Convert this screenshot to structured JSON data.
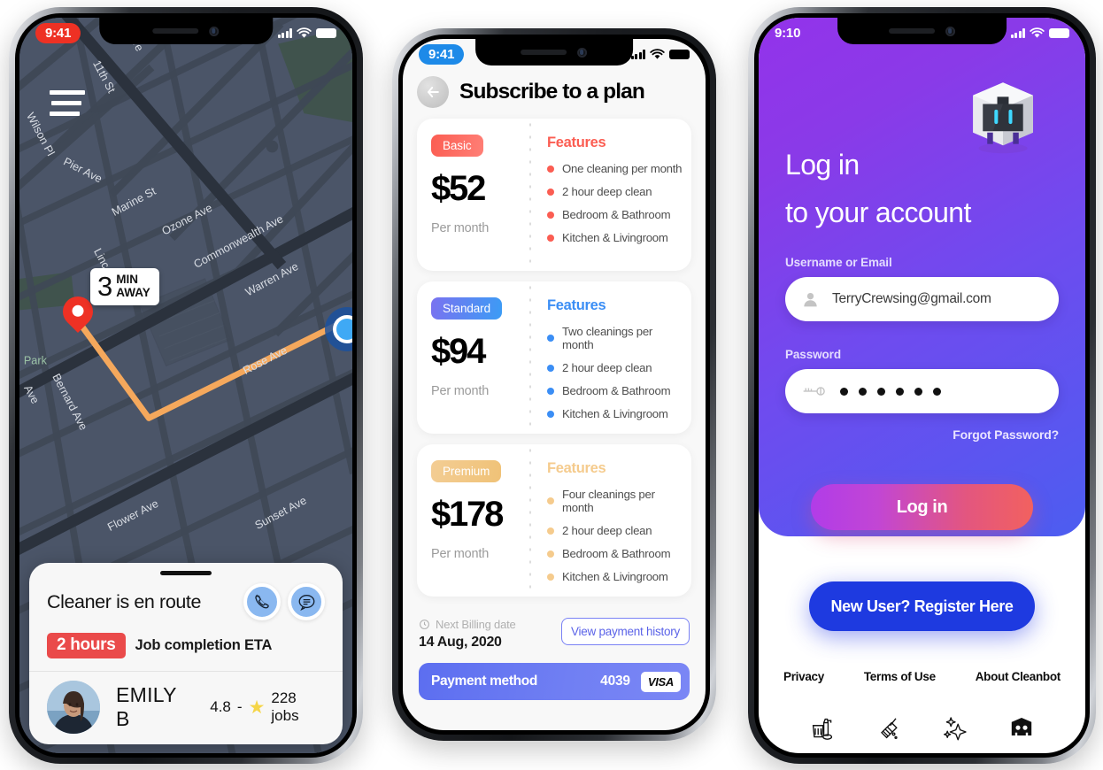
{
  "phone1": {
    "name": "cleaner-tracking-map",
    "status": {
      "time": "9:41",
      "time_bg": "#ee3124",
      "time_color": "#ffffff",
      "signal": "signal-bars-icon",
      "wifi": "wifi-icon",
      "battery": "battery-icon"
    },
    "menu_icon": "hamburger-menu-icon",
    "map": {
      "bg_color": "#4b5568",
      "road_color": "#3b4351",
      "park_color": "#3c5148",
      "route_color": "#f5a85c",
      "street_labels": [
        "11th St",
        "Wilson Pl",
        "Pier Ave",
        "Marine St",
        "Ozone Ave",
        "Commonwealth Ave",
        "Warren Ave",
        "Lincoln Blvd",
        "Rose Ave",
        "Bernard Ave",
        "Flower Ave",
        "Sunset Ave",
        "Park"
      ]
    },
    "eta_badge": {
      "number": "3",
      "line1": "MIN",
      "line2": "AWAY"
    },
    "card": {
      "title": "Cleaner is en route",
      "call_icon": "phone-call-icon",
      "chat_icon": "chat-bubble-icon",
      "eta_value": "2 hours",
      "eta_label": "Job completion ETA",
      "cleaner_name": "EMILY B",
      "rating": "4.8",
      "rating_sep": "-",
      "star_icon": "star-icon",
      "jobs": "228 jobs"
    }
  },
  "phone2": {
    "name": "subscribe-to-a-plan",
    "status": {
      "time": "9:41",
      "time_bg": "#1d8ae8",
      "time_color": "#ffffff",
      "signal": "signal-bars-icon",
      "wifi": "wifi-icon",
      "battery": "battery-icon"
    },
    "back_icon": "back-arrow-icon",
    "title": "Subscribe to a plan",
    "features_heading": "Features",
    "per_month": "Per month",
    "plans": [
      {
        "tag": "Basic",
        "tag_color": "#fb5d52",
        "accent": "#fb5d52",
        "price": "$52",
        "features": [
          "One cleaning per month",
          "2 hour deep clean",
          "Bedroom & Bathroom",
          "Kitchen & Livingroom"
        ]
      },
      {
        "tag": "Standard",
        "tag_color": "#4b8ef4",
        "accent": "#3b8ef5",
        "price": "$94",
        "features": [
          "Two cleanings per month",
          "2 hour deep clean",
          "Bedroom & Bathroom",
          "Kitchen & Livingroom"
        ]
      },
      {
        "tag": "Premium",
        "tag_color": "#f2c98c",
        "accent": "#f5cb8d",
        "price": "$178",
        "features": [
          "Four cleanings per month",
          "2 hour deep clean",
          "Bedroom & Bathroom",
          "Kitchen & Livingroom"
        ]
      }
    ],
    "billing": {
      "clock_icon": "clock-icon",
      "label": "Next Billing date",
      "date": "14 Aug, 2020",
      "history_button": "View payment history"
    },
    "payment": {
      "label": "Payment method",
      "last4": "4039",
      "brand": "VISA",
      "bar_color": "#6b7bf2"
    }
  },
  "phone3": {
    "name": "login-screen",
    "status": {
      "time": "9:10",
      "time_color": "#ffffff",
      "signal": "signal-bars-icon",
      "wifi": "wifi-icon",
      "battery": "battery-icon"
    },
    "logo_icon": "cleanbot-robot-logo",
    "heading_line1": "Log in",
    "heading_line2": "to your account",
    "username": {
      "label": "Username or Email",
      "value": "TerryCrewsing@gmail.com",
      "placeholder": "Username or Email",
      "icon": "user-avatar-icon"
    },
    "password": {
      "label": "Password",
      "masked": "• • • • • •",
      "dot_count": 6,
      "placeholder": "Password",
      "icon": "key-icon"
    },
    "forgot": "Forgot Password?",
    "login_button": "Log in",
    "register_button": "New User? Register Here",
    "links": [
      "Privacy",
      "Terms of Use",
      "About Cleanbot"
    ],
    "nav_icons": [
      "cleaning-supplies-icon",
      "broom-icon",
      "sparkles-icon",
      "robot-icon"
    ],
    "colors": {
      "purple": "#9333ea",
      "blue": "#4c5df0",
      "register_blue": "#1e3ae0"
    }
  }
}
